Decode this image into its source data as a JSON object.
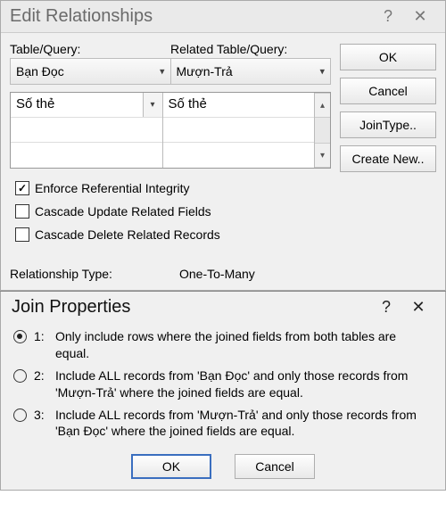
{
  "editDialog": {
    "title": "Edit Relationships",
    "tableLabel": "Table/Query:",
    "relatedLabel": "Related Table/Query:",
    "tableValue": "Bạn Đọc",
    "relatedValue": "Mượn-Trả",
    "fieldLeft": "Số thẻ",
    "fieldRight": "Số thẻ",
    "checks": {
      "enforce": {
        "label": "Enforce Referential Integrity",
        "checked": true
      },
      "cascadeUpdate": {
        "label": "Cascade Update Related Fields",
        "checked": false
      },
      "cascadeDelete": {
        "label": "Cascade Delete Related Records",
        "checked": false
      }
    },
    "relTypeLabel": "Relationship Type:",
    "relTypeValue": "One-To-Many",
    "buttons": {
      "ok": "OK",
      "cancel": "Cancel",
      "joinType": "JoinType..",
      "createNew": "Create New.."
    }
  },
  "joinDialog": {
    "title": "Join Properties",
    "options": [
      {
        "num": "1:",
        "text": "Only include rows where the joined fields from both tables are equal.",
        "selected": true
      },
      {
        "num": "2:",
        "text": "Include ALL records from 'Bạn Đọc' and only those records from 'Mượn-Trả' where the joined fields are equal.",
        "selected": false
      },
      {
        "num": "3:",
        "text": "Include ALL records from 'Mượn-Trả' and only those records from 'Bạn Đọc' where the joined fields are equal.",
        "selected": false
      }
    ],
    "buttons": {
      "ok": "OK",
      "cancel": "Cancel"
    }
  }
}
